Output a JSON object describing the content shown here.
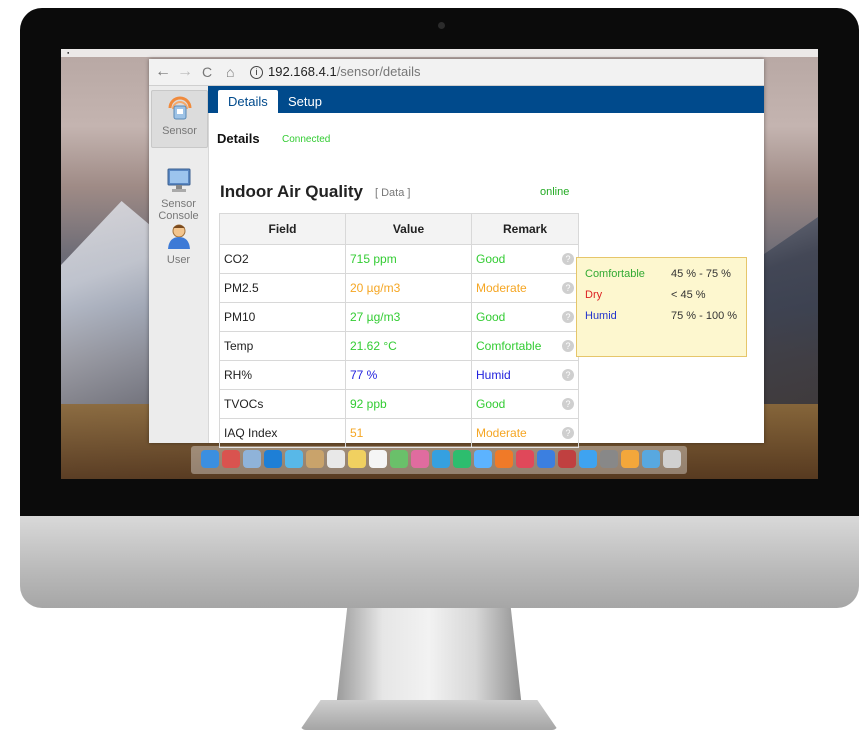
{
  "browser": {
    "back_glyph": "←",
    "forward_glyph": "→",
    "reload_glyph": "C",
    "home_glyph": "⌂",
    "info_glyph": "i",
    "url_host": "192.168.4.1",
    "url_path": "/sensor/details"
  },
  "sidebar": {
    "items": [
      {
        "label": "Sensor",
        "icon": "sensor-icon"
      },
      {
        "label": "Sensor\nConsole",
        "icon": "monitor-icon"
      },
      {
        "label": "User",
        "icon": "user-icon"
      }
    ]
  },
  "tabs": [
    {
      "label": "Details"
    },
    {
      "label": "Setup"
    }
  ],
  "section": {
    "title": "Details",
    "status": "Connected"
  },
  "card": {
    "title": "Indoor Air Quality",
    "subtitle": "[ Data ]",
    "online": "online"
  },
  "table": {
    "headers": [
      "Field",
      "Value",
      "Remark"
    ],
    "rows": [
      {
        "field": "CO2",
        "value": "715 ppm",
        "remark": "Good",
        "value_color": "#33cc33",
        "remark_color": "#33cc33"
      },
      {
        "field": "PM2.5",
        "value": "20 µg/m3",
        "remark": "Moderate",
        "value_color": "#f5a623",
        "remark_color": "#f5a623"
      },
      {
        "field": "PM10",
        "value": "27 µg/m3",
        "remark": "Good",
        "value_color": "#33cc33",
        "remark_color": "#33cc33"
      },
      {
        "field": "Temp",
        "value": "21.62 °C",
        "remark": "Comfortable",
        "value_color": "#33cc33",
        "remark_color": "#33cc33"
      },
      {
        "field": "RH%",
        "value": "77 %",
        "remark": "Humid",
        "value_color": "#2222dd",
        "remark_color": "#2222dd"
      },
      {
        "field": "TVOCs",
        "value": "92 ppb",
        "remark": "Good",
        "value_color": "#33cc33",
        "remark_color": "#33cc33"
      },
      {
        "field": "IAQ Index",
        "value": "51",
        "remark": "Moderate",
        "value_color": "#f5a623",
        "remark_color": "#f5a623"
      }
    ],
    "help_glyph": "?"
  },
  "popup": {
    "rows": [
      {
        "label": "Comfortable",
        "range": "45 % - 75 %",
        "color": "#33aa33"
      },
      {
        "label": "Dry",
        "range": "< 45 %",
        "color": "#dd2222"
      },
      {
        "label": "Humid",
        "range": "75 % - 100 %",
        "color": "#2233cc"
      }
    ]
  },
  "colors": {
    "accent": "#004a8c",
    "good": "#33cc33",
    "moderate": "#f5a623",
    "humid": "#2222dd"
  }
}
